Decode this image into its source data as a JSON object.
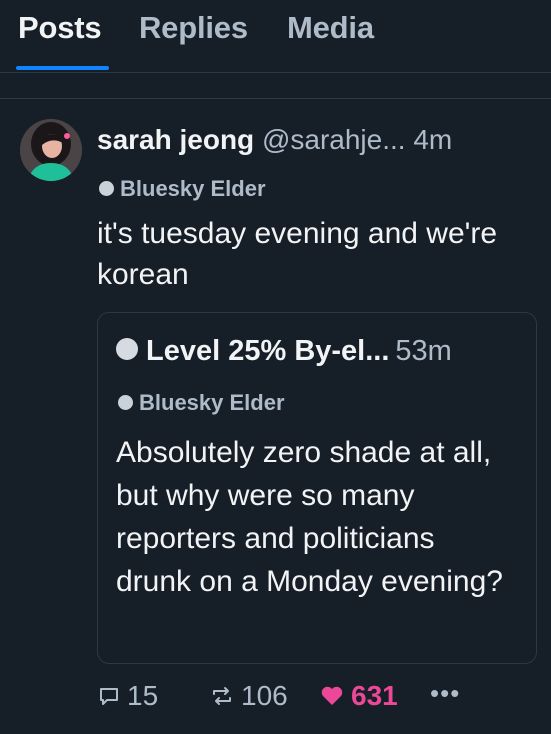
{
  "tabs": [
    {
      "label": "Posts",
      "active": true
    },
    {
      "label": "Replies",
      "active": false
    },
    {
      "label": "Media",
      "active": false
    }
  ],
  "post": {
    "author": {
      "display_name": "sarah jeong",
      "handle": "@sarahje...",
      "avatar_icon": "avatar"
    },
    "time": "4m",
    "badge": {
      "icon": "bluesky-elder-icon",
      "label": "Bluesky Elder"
    },
    "text": "it's tuesday evening and we're korean",
    "quote": {
      "author": {
        "display_name": "Level 25% By-el...",
        "avatar_icon": "level-avatar-icon"
      },
      "time": "53m",
      "badge": {
        "icon": "bluesky-elder-icon",
        "label": "Bluesky Elder"
      },
      "text": "Absolutely zero shade at all, but why were so many reporters and politicians drunk on a Monday evening?"
    },
    "actions": {
      "replies": "15",
      "reposts": "106",
      "likes": "631",
      "more_icon": "more-icon"
    }
  },
  "colors": {
    "background": "#161e27",
    "accent": "#1083fe",
    "like": "#ec4899",
    "muted": "#aebbc9"
  }
}
